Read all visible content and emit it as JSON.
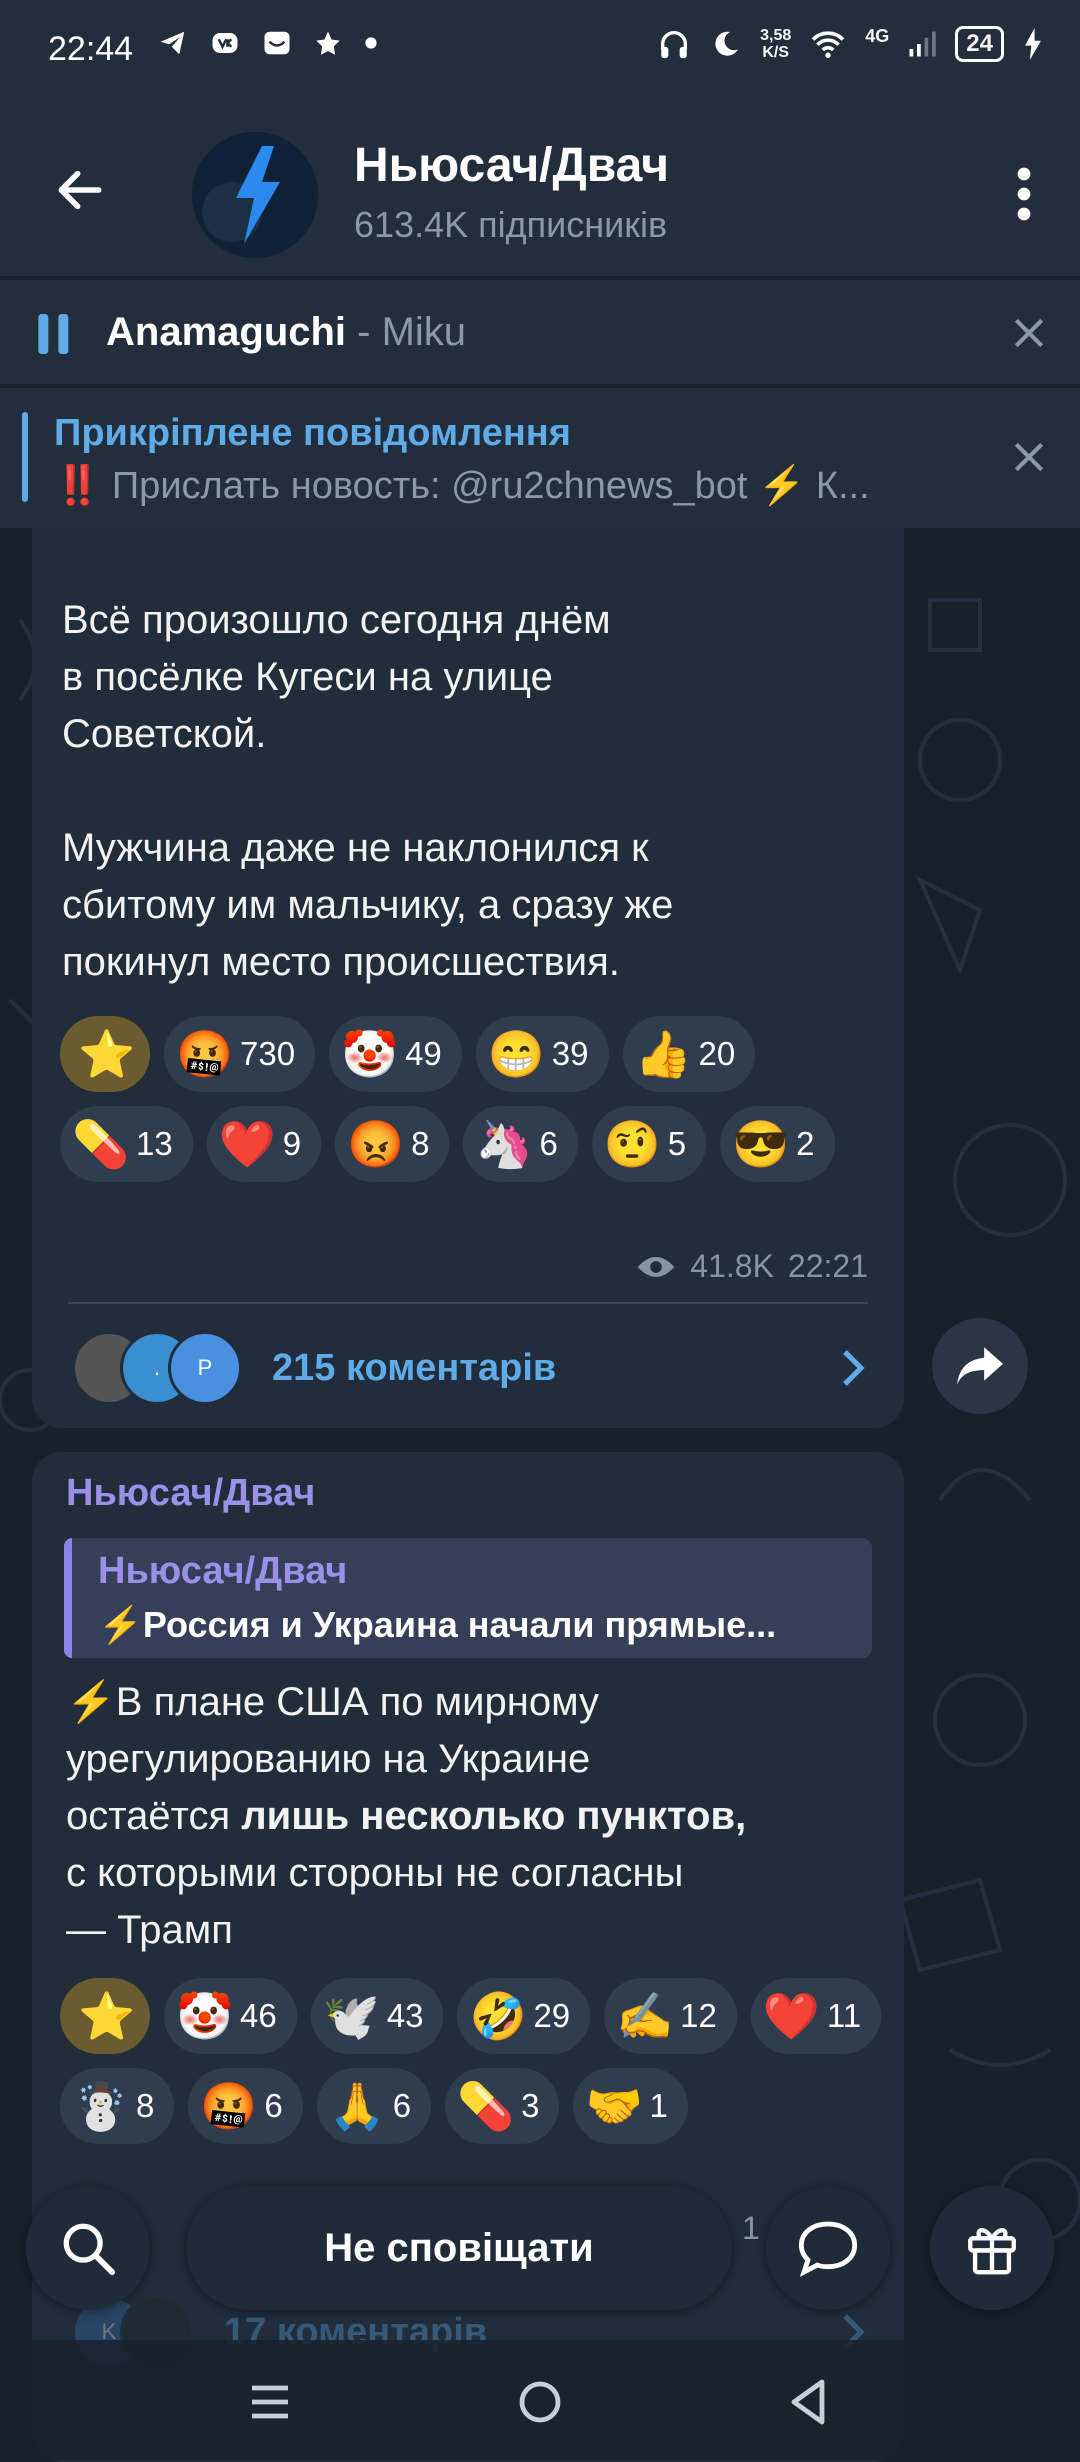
{
  "status_bar": {
    "time": "22:44",
    "speed_value": "3,58",
    "speed_unit": "K/S",
    "network": "4G",
    "battery": "24",
    "left_icons": [
      "telegram-icon",
      "vk-icon",
      "mail-icon",
      "star-icon",
      "dot-icon"
    ],
    "right_icons": [
      "headphones-icon",
      "moon-icon",
      "wifi-icon",
      "signal-icon",
      "charging-icon"
    ]
  },
  "header": {
    "title": "Ньюсач/Двач",
    "subtitle": "613.4K підписників"
  },
  "audio_player": {
    "artist": "Anamaguchi",
    "separator": " - ",
    "song": "Miku"
  },
  "pinned": {
    "title": "Прикріплене повідомлення",
    "text": "‼️ Прислать новость: @ru2chnews_bot ⚡ К..."
  },
  "message1": {
    "text": "Всё произошло сегодня днём\nв посёлке Кугеси на улице\nСоветской.\n\nМужчина даже не наклонился к\nсбитому им мальчику, а сразу же\nпокинул место происшествия.",
    "reactions": [
      {
        "emoji": "⭐",
        "count": ""
      },
      {
        "emoji": "🤬",
        "count": "730"
      },
      {
        "emoji": "🤡",
        "count": "49"
      },
      {
        "emoji": "😁",
        "count": "39"
      },
      {
        "emoji": "👍",
        "count": "20"
      },
      {
        "emoji": "💊",
        "count": "13"
      },
      {
        "emoji": "❤️",
        "count": "9"
      },
      {
        "emoji": "😡",
        "count": "8"
      },
      {
        "emoji": "🦄",
        "count": "6"
      },
      {
        "emoji": "🤨",
        "count": "5"
      },
      {
        "emoji": "😎",
        "count": "2"
      }
    ],
    "views": "41.8K",
    "time": "22:21",
    "comments": "215 коментарів",
    "commenter_initials": [
      "",
      ".",
      "P"
    ]
  },
  "message2": {
    "author": "Ньюсач/Двач",
    "quote_author": "Ньюсач/Двач",
    "quote_text": "⚡Россия и Украина начали прямые...",
    "text_before": "⚡В плане США по мирному\nурегулированию на Украине\nостаётся ",
    "text_bold": "лишь несколько пунктов,",
    "text_after": "\nс которыми стороны не согласны\n— Трамп",
    "reactions": [
      {
        "emoji": "⭐",
        "count": ""
      },
      {
        "emoji": "🤡",
        "count": "46"
      },
      {
        "emoji": "🕊️",
        "count": "43"
      },
      {
        "emoji": "🤣",
        "count": "29"
      },
      {
        "emoji": "✍️",
        "count": "12"
      },
      {
        "emoji": "❤️",
        "count": "11"
      },
      {
        "emoji": "☃️",
        "count": "8"
      },
      {
        "emoji": "🤬",
        "count": "6"
      },
      {
        "emoji": "🙏",
        "count": "6"
      },
      {
        "emoji": "💊",
        "count": "3"
      },
      {
        "emoji": "🤝",
        "count": "1"
      }
    ],
    "comments": "17 коментарів",
    "commenter_initials": [
      "K",
      ""
    ]
  },
  "bottom_bar": {
    "mute_label": "Не сповіщати",
    "partial_count": "1"
  },
  "colors": {
    "background": "#17212b",
    "header": "#232e3c",
    "bubble": "#212d3b",
    "accent": "#5eabe8",
    "forward_name": "#9a90ea"
  }
}
